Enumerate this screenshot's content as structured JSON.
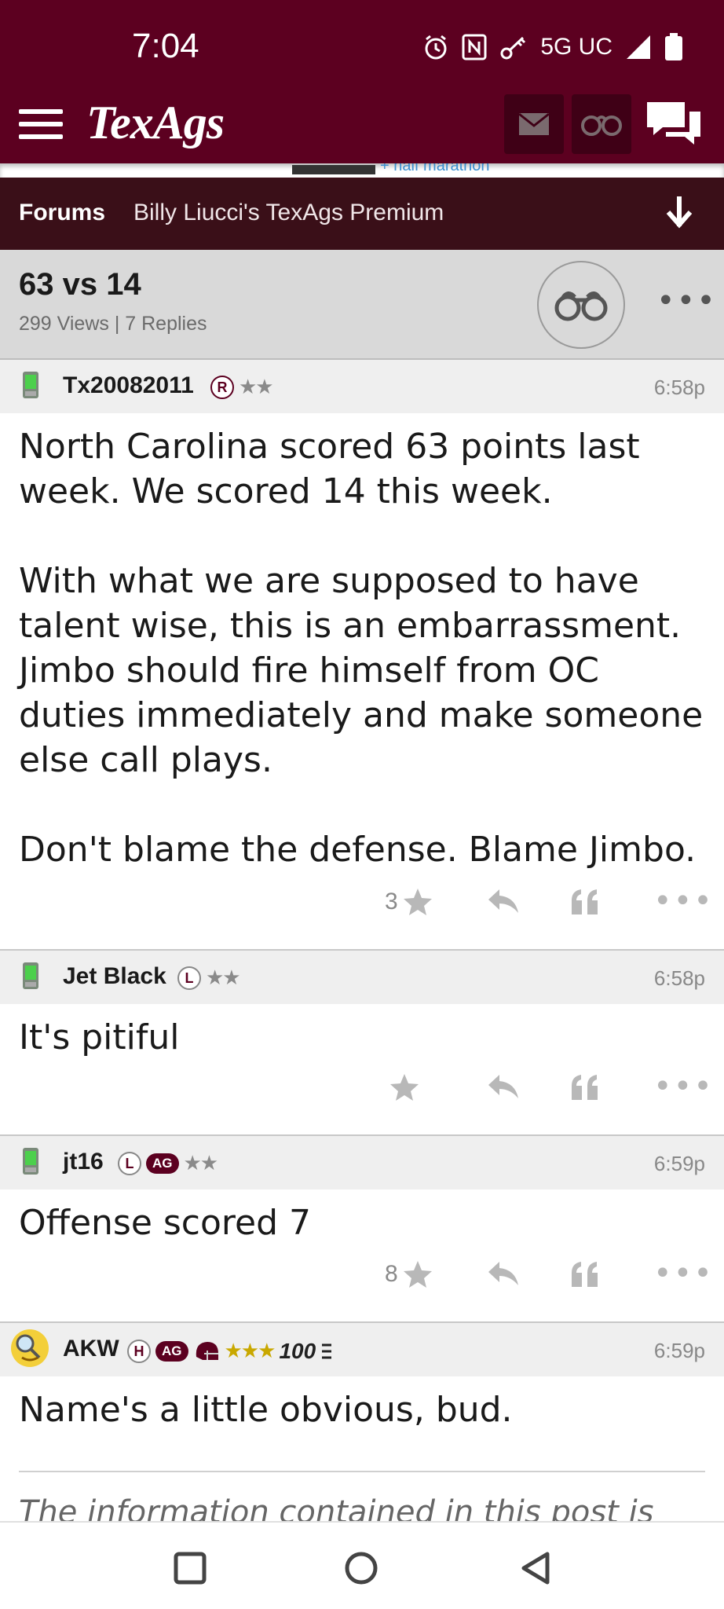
{
  "status_bar": {
    "time": "7:04",
    "network": "5G UC",
    "icons": [
      "alarm-icon",
      "nfc-icon",
      "key-icon",
      "signal-icon",
      "battery-icon"
    ]
  },
  "app_header": {
    "logo": "TexAgs",
    "buttons": [
      "menu-icon",
      "mail-icon",
      "binoculars-icon",
      "chat-icon"
    ]
  },
  "ad": {
    "text": "+ half marathon"
  },
  "breadcrumb": {
    "forums_label": "Forums",
    "board_label": "Billy Liucci's TexAgs Premium"
  },
  "thread": {
    "title": "63 vs 14",
    "meta": "299 Views | 7 Replies"
  },
  "posts": [
    {
      "username": "Tx20082011",
      "badges": [
        "R"
      ],
      "stars": "★★",
      "time": "6:58p",
      "body": "North Carolina scored 63 points last week. We scored 14 this week.\n\nWith what we are supposed to have talent wise, this is an embarrassment. Jimbo should fire himself from OC duties immediately and make someone else call plays.\n\nDon't blame the defense. Blame Jimbo.",
      "star_count": "3"
    },
    {
      "username": "Jet Black",
      "badges": [
        "L"
      ],
      "stars": "★★",
      "time": "6:58p",
      "body": "It's pitiful",
      "star_count": ""
    },
    {
      "username": "jt16",
      "badges": [
        "L",
        "AG"
      ],
      "stars": "★★",
      "time": "6:59p",
      "body": "Offense scored 7",
      "star_count": "8"
    },
    {
      "username": "AKW",
      "badges": [
        "H",
        "AG"
      ],
      "stars": "★★★",
      "extra_badge": "100",
      "time": "6:59p",
      "body": "Name's a little obvious, bud.",
      "disclaimer": "The information contained in this post is"
    }
  ],
  "colors": {
    "maroon": "#5c0020",
    "breadcrumb_bg": "#3a0f18",
    "thread_header_bg": "#d9d9d9",
    "post_header_bg": "#efefef"
  }
}
